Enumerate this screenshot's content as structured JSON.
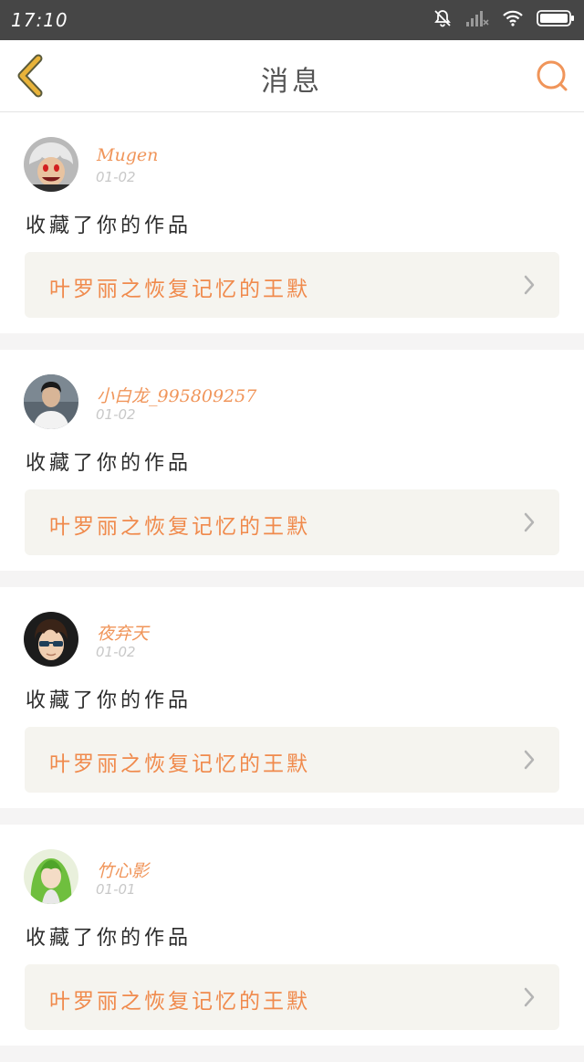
{
  "status_bar": {
    "time": "17:10"
  },
  "nav": {
    "title": "消息"
  },
  "messages": [
    {
      "username": "Mugen",
      "date": "01-02",
      "action": "收藏了你的作品",
      "work_title": "叶罗丽之恢复记忆的王默",
      "avatar": "avatar-red-hair"
    },
    {
      "username": "小白龙_995809257",
      "date": "01-02",
      "action": "收藏了你的作品",
      "work_title": "叶罗丽之恢复记忆的王默",
      "avatar": "avatar-photo-man"
    },
    {
      "username": "夜弃天",
      "date": "01-02",
      "action": "收藏了你的作品",
      "work_title": "叶罗丽之恢复记忆的王默",
      "avatar": "avatar-sunglasses"
    },
    {
      "username": "竹心影",
      "date": "01-01",
      "action": "收藏了你的作品",
      "work_title": "叶罗丽之恢复记忆的王默",
      "avatar": "avatar-green-hair"
    }
  ],
  "colors": {
    "accent": "#f0955a",
    "status_bar": "#464646",
    "back_icon": "#e8b33a"
  }
}
